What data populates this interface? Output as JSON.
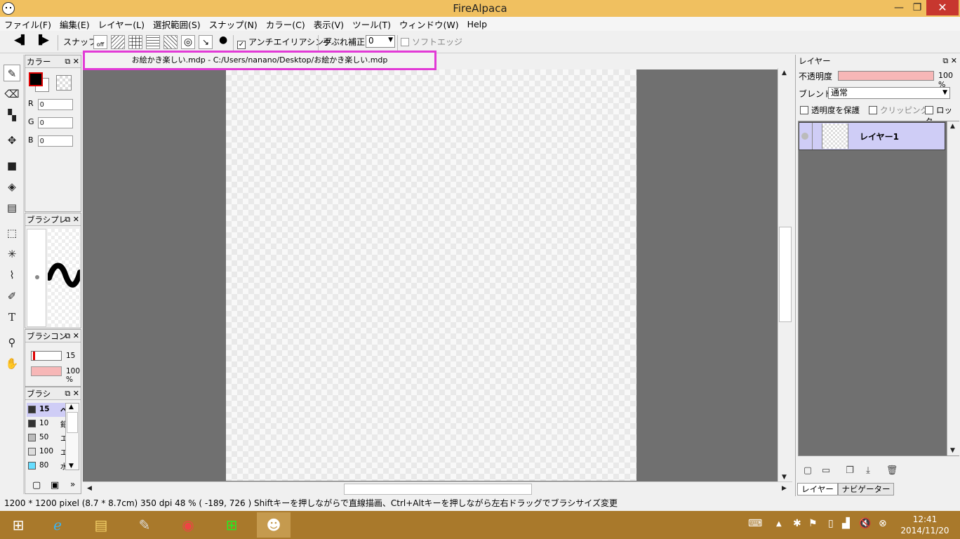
{
  "window": {
    "title": "FireAlpaca",
    "minimize": "—",
    "maximize": "❐",
    "close": "✕"
  },
  "menu": [
    "ファイル(F)",
    "編集(E)",
    "レイヤー(L)",
    "選択範囲(S)",
    "スナップ(N)",
    "カラー(C)",
    "表示(V)",
    "ツール(T)",
    "ウィンドウ(W)",
    "Help"
  ],
  "toolbar": {
    "snap_label": "スナップ",
    "snap_off": "off",
    "antialias_label": "アンチエイリアシング",
    "antialias_checked": "✓",
    "stabilizer_label": "手ぶれ補正",
    "stabilizer_value": "0",
    "softedge_label": "ソフトエッジ"
  },
  "tools": [
    "pen-tool",
    "eraser-tool",
    "dot-tool",
    "move-tool",
    "fill-rect-tool",
    "bucket-tool",
    "gradient-tool",
    "select-tool",
    "magic-wand-tool",
    "lasso-tool",
    "select-pen-tool",
    "text-tool",
    "eyedropper-tool",
    "hand-tool"
  ],
  "color_panel": {
    "title": "カラー",
    "r_label": "R",
    "r_value": "0",
    "g_label": "G",
    "g_value": "0",
    "b_label": "B",
    "b_value": "0",
    "primary_color": "#000000"
  },
  "brush_preview_panel": {
    "title": "ブラシプレ"
  },
  "brush_control_panel": {
    "title": "ブラシコン",
    "size_value": "15",
    "opacity_value": "100 %"
  },
  "brush_panel": {
    "title": "ブラシ",
    "items": [
      {
        "size": "15",
        "name": "ペ",
        "color": "#333333"
      },
      {
        "size": "10",
        "name": "鉛",
        "color": "#333333"
      },
      {
        "size": "50",
        "name": "エ",
        "color": "#bbbbbb"
      },
      {
        "size": "100",
        "name": "エ",
        "color": "#dddddd"
      },
      {
        "size": "80",
        "name": "水",
        "color": "#66ddff"
      }
    ]
  },
  "document": {
    "tab_title": "お絵かき楽しい.mdp - C:/Users/nanano/Desktop/お絵かき楽しい.mdp"
  },
  "status_bar": {
    "text": "1200 * 1200 pixel   (8.7 * 8.7cm)   350 dpi   48 %   ( -189, 726 )   Shiftキーを押しながらで直線描画、Ctrl+Altキーを押しながら左右ドラッグでブラシサイズ変更"
  },
  "layer_panel": {
    "title": "レイヤー",
    "opacity_label": "不透明度",
    "opacity_value": "100 %",
    "blend_label": "ブレンド",
    "blend_value": "通常",
    "protect_alpha_label": "透明度を保護",
    "clipping_label": "クリッピング",
    "lock_label": "ロック",
    "layers": [
      {
        "name": "レイヤー1"
      }
    ],
    "tab_layer": "レイヤー",
    "tab_navigator": "ナビゲーター"
  },
  "taskbar": {
    "apps": [
      "windows-start",
      "internet-explorer",
      "file-explorer",
      "paint-app",
      "chrome",
      "store",
      "firealpaca"
    ],
    "time": "12:41",
    "date": "2014/11/20"
  }
}
